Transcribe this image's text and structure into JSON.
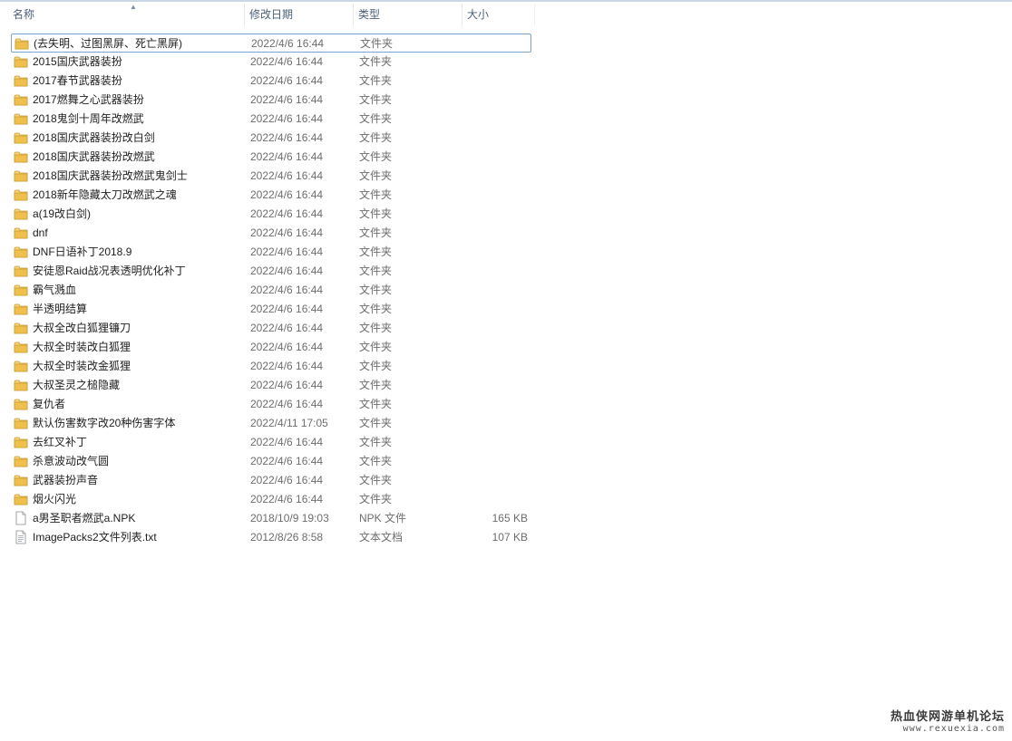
{
  "columns": {
    "name": "名称",
    "date": "修改日期",
    "type": "类型",
    "size": "大小"
  },
  "files": [
    {
      "name": "(去失明、过图黑屏、死亡黑屏)",
      "date": "2022/4/6 16:44",
      "type": "文件夹",
      "size": "",
      "icon": "folder-icon"
    },
    {
      "name": "2015国庆武器装扮",
      "date": "2022/4/6 16:44",
      "type": "文件夹",
      "size": "",
      "icon": "folder-icon"
    },
    {
      "name": "2017春节武器装扮",
      "date": "2022/4/6 16:44",
      "type": "文件夹",
      "size": "",
      "icon": "folder-icon"
    },
    {
      "name": "2017燃舞之心武器装扮",
      "date": "2022/4/6 16:44",
      "type": "文件夹",
      "size": "",
      "icon": "folder-icon"
    },
    {
      "name": "2018鬼剑十周年改燃武",
      "date": "2022/4/6 16:44",
      "type": "文件夹",
      "size": "",
      "icon": "folder-icon"
    },
    {
      "name": "2018国庆武器装扮改白剑",
      "date": "2022/4/6 16:44",
      "type": "文件夹",
      "size": "",
      "icon": "folder-icon"
    },
    {
      "name": "2018国庆武器装扮改燃武",
      "date": "2022/4/6 16:44",
      "type": "文件夹",
      "size": "",
      "icon": "folder-icon"
    },
    {
      "name": "2018国庆武器装扮改燃武鬼剑士",
      "date": "2022/4/6 16:44",
      "type": "文件夹",
      "size": "",
      "icon": "folder-icon"
    },
    {
      "name": "2018新年隐藏太刀改燃武之魂",
      "date": "2022/4/6 16:44",
      "type": "文件夹",
      "size": "",
      "icon": "folder-icon"
    },
    {
      "name": "a(19改白剑)",
      "date": "2022/4/6 16:44",
      "type": "文件夹",
      "size": "",
      "icon": "folder-icon"
    },
    {
      "name": "dnf",
      "date": "2022/4/6 16:44",
      "type": "文件夹",
      "size": "",
      "icon": "folder-icon"
    },
    {
      "name": "DNF日语补丁2018.9",
      "date": "2022/4/6 16:44",
      "type": "文件夹",
      "size": "",
      "icon": "folder-icon"
    },
    {
      "name": "安徒恩Raid战况表透明优化补丁",
      "date": "2022/4/6 16:44",
      "type": "文件夹",
      "size": "",
      "icon": "folder-icon"
    },
    {
      "name": "霸气溅血",
      "date": "2022/4/6 16:44",
      "type": "文件夹",
      "size": "",
      "icon": "folder-icon"
    },
    {
      "name": "半透明结算",
      "date": "2022/4/6 16:44",
      "type": "文件夹",
      "size": "",
      "icon": "folder-icon"
    },
    {
      "name": "大叔全改白狐狸镰刀",
      "date": "2022/4/6 16:44",
      "type": "文件夹",
      "size": "",
      "icon": "folder-icon"
    },
    {
      "name": "大叔全时装改白狐狸",
      "date": "2022/4/6 16:44",
      "type": "文件夹",
      "size": "",
      "icon": "folder-icon"
    },
    {
      "name": "大叔全时装改金狐狸",
      "date": "2022/4/6 16:44",
      "type": "文件夹",
      "size": "",
      "icon": "folder-icon"
    },
    {
      "name": "大叔圣灵之槌隐藏",
      "date": "2022/4/6 16:44",
      "type": "文件夹",
      "size": "",
      "icon": "folder-icon"
    },
    {
      "name": "复仇者",
      "date": "2022/4/6 16:44",
      "type": "文件夹",
      "size": "",
      "icon": "folder-icon"
    },
    {
      "name": "默认伤害数字改20种伤害字体",
      "date": "2022/4/11 17:05",
      "type": "文件夹",
      "size": "",
      "icon": "folder-icon"
    },
    {
      "name": "去红叉补丁",
      "date": "2022/4/6 16:44",
      "type": "文件夹",
      "size": "",
      "icon": "folder-icon"
    },
    {
      "name": "杀意波动改气圆",
      "date": "2022/4/6 16:44",
      "type": "文件夹",
      "size": "",
      "icon": "folder-icon"
    },
    {
      "name": "武器装扮声音",
      "date": "2022/4/6 16:44",
      "type": "文件夹",
      "size": "",
      "icon": "folder-icon"
    },
    {
      "name": "烟火闪光",
      "date": "2022/4/6 16:44",
      "type": "文件夹",
      "size": "",
      "icon": "folder-icon"
    },
    {
      "name": "a男圣职者燃武a.NPK",
      "date": "2018/10/9 19:03",
      "type": "NPK 文件",
      "size": "165 KB",
      "icon": "file-icon"
    },
    {
      "name": "ImagePacks2文件列表.txt",
      "date": "2012/8/26 8:58",
      "type": "文本文档",
      "size": "107 KB",
      "icon": "text-file-icon"
    }
  ],
  "focused_index": 0,
  "watermark": {
    "title": "热血侠网游单机论坛",
    "url": "www.rexuexia.com"
  },
  "colors": {
    "folder": "#e8b83a",
    "focus_border": "#7da2ce",
    "header_text": "#4c607a"
  }
}
